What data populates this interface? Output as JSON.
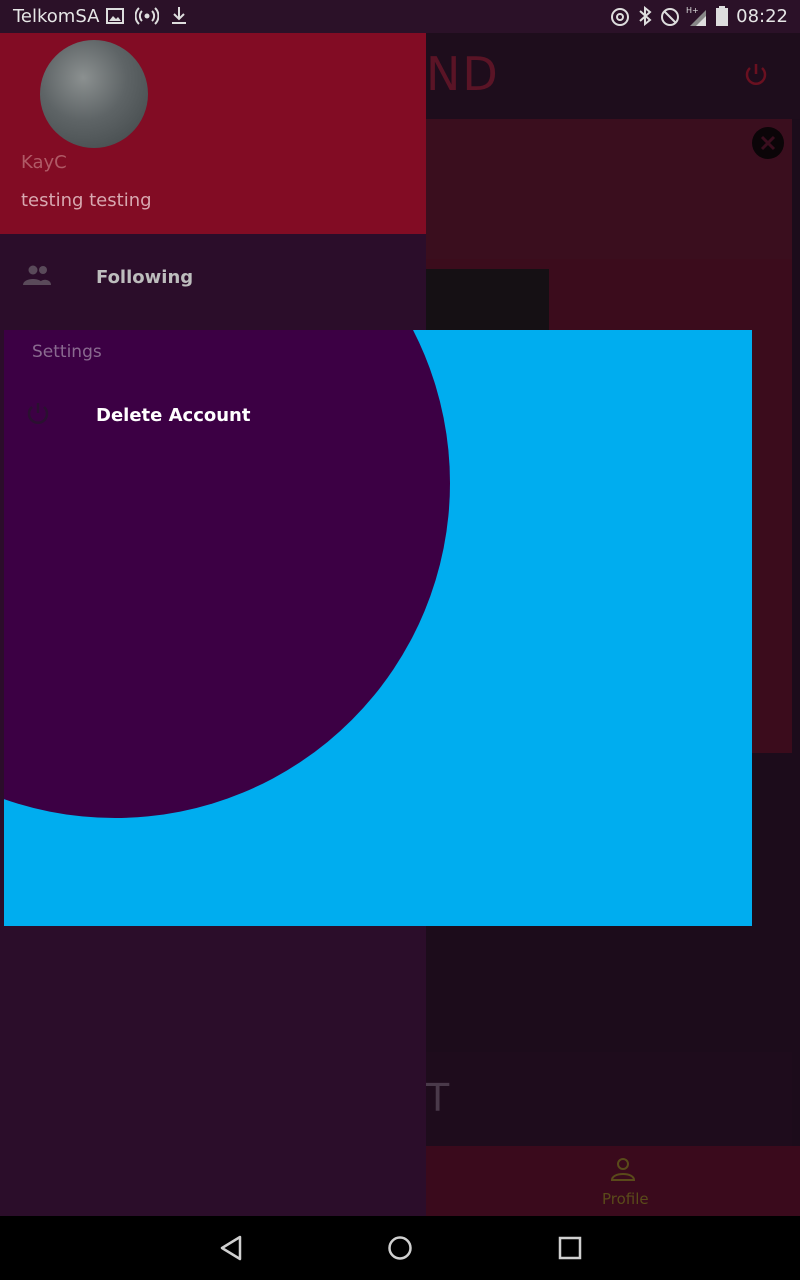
{
  "status_bar": {
    "carrier": "TelkomSA",
    "time": "08:22"
  },
  "app": {
    "title": "ND",
    "post_field_fragment": "T",
    "nav": {
      "profile_label": "Profile"
    }
  },
  "drawer": {
    "user": {
      "name": "KayC",
      "bio": "testing testing"
    },
    "items": [
      {
        "label": "Following",
        "icon": "people-icon"
      },
      {
        "label": "Delete Account",
        "icon": "power-icon"
      }
    ],
    "section_label": "Settings"
  },
  "colors": {
    "drawer_header": "#820c24",
    "overlay_panel": "#00adef",
    "reveal_circle": "#3c0044"
  }
}
